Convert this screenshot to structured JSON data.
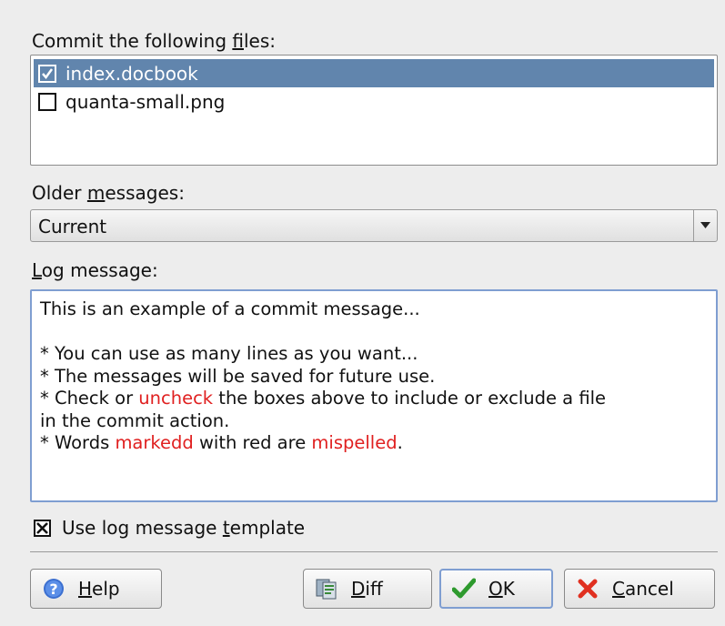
{
  "files_label_pre": "Commit the following ",
  "files_label_acc": "f",
  "files_label_post": "iles:",
  "files": [
    {
      "name": "index.docbook",
      "checked": true,
      "selected": true
    },
    {
      "name": "quanta-small.png",
      "checked": false,
      "selected": false
    }
  ],
  "older_label_pre": "Older ",
  "older_label_acc": "m",
  "older_label_post": "essages:",
  "older_value": "Current",
  "log_label_acc": "L",
  "log_label_post": "og message:",
  "log_lines": [
    {
      "parts": [
        {
          "t": "This is an example of a commit message..."
        }
      ]
    },
    {
      "parts": [
        {
          "t": ""
        }
      ]
    },
    {
      "parts": [
        {
          "t": "* You can use as many lines as you want..."
        }
      ]
    },
    {
      "parts": [
        {
          "t": "* The messages will be saved for future use."
        }
      ]
    },
    {
      "parts": [
        {
          "t": "* Check or "
        },
        {
          "t": "uncheck",
          "red": true
        },
        {
          "t": " the boxes above to include or exclude a file"
        }
      ]
    },
    {
      "parts": [
        {
          "t": "in the commit action."
        }
      ]
    },
    {
      "parts": [
        {
          "t": "* Words "
        },
        {
          "t": "markedd",
          "red": true
        },
        {
          "t": " with red are "
        },
        {
          "t": "mispelled",
          "red": true
        },
        {
          "t": "."
        }
      ]
    }
  ],
  "template_pre": "Use log message ",
  "template_acc": "t",
  "template_post": "emplate",
  "template_checked": true,
  "buttons": {
    "help": {
      "acc": "H",
      "rest": "elp",
      "icon": "help-icon"
    },
    "diff": {
      "acc": "D",
      "rest": "iff",
      "icon": "diff-icon"
    },
    "ok": {
      "acc": "O",
      "rest": "K",
      "icon": "checkmark-icon"
    },
    "cancel": {
      "acc": "C",
      "rest": "ancel",
      "icon": "cancel-x-icon"
    }
  },
  "colors": {
    "selection": "#6185ad",
    "misspelled": "#e02020",
    "focus_border": "#7f9ed1"
  }
}
